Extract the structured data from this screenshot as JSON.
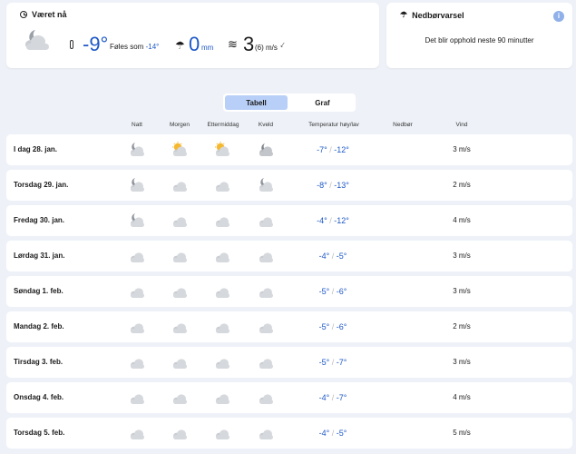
{
  "now": {
    "title": "Været nå",
    "temperature": "-9°",
    "feels_like_label": "Føles som",
    "feels_like_value": "-14°",
    "precipitation": "0",
    "precipitation_unit": "mm",
    "wind": "3",
    "gust": "(6) m/s",
    "icons": {
      "clock": "clock-icon",
      "symbol": "cloudy-moon-icon",
      "thermometer": "thermometer-icon",
      "umbrella": "umbrella-icon",
      "wind": "wind-icon",
      "direction": "wind-direction-arrow-icon"
    }
  },
  "precip_forecast": {
    "title": "Nedbørvarsel",
    "message": "Det blir opphold neste 90 minutter",
    "info": "i"
  },
  "view_toggle": {
    "table_label": "Tabell",
    "graph_label": "Graf",
    "active": "Tabell"
  },
  "columns": {
    "night": "Natt",
    "morning": "Morgen",
    "afternoon": "Ettermiddag",
    "evening": "Kveld",
    "temperature": "Temperatur høy/lav",
    "precipitation": "Nedbør",
    "wind": "Vind"
  },
  "colors": {
    "temperature": "#1e58c7",
    "active_tab": "#b8cff7",
    "background": "#eef2f8"
  },
  "rows": [
    {
      "day": "I dag 28. jan.",
      "symbols": [
        "moon-cloud",
        "sun-cloud",
        "sun-cloud",
        "moon-cloud-dark"
      ],
      "high": "-7°",
      "low": "-12°",
      "wind": "3 m/s"
    },
    {
      "day": "Torsdag 29. jan.",
      "symbols": [
        "moon-cloud",
        "cloud",
        "cloud",
        "moon-cloud"
      ],
      "high": "-8°",
      "low": "-13°",
      "wind": "2 m/s"
    },
    {
      "day": "Fredag 30. jan.",
      "symbols": [
        "moon-cloud",
        "cloud",
        "cloud",
        "cloud"
      ],
      "high": "-4°",
      "low": "-12°",
      "wind": "4 m/s"
    },
    {
      "day": "Lørdag 31. jan.",
      "symbols": [
        "cloud",
        "cloud",
        "cloud",
        "cloud"
      ],
      "high": "-4°",
      "low": "-5°",
      "wind": "3 m/s"
    },
    {
      "day": "Søndag 1. feb.",
      "symbols": [
        "cloud",
        "cloud",
        "cloud",
        "cloud"
      ],
      "high": "-5°",
      "low": "-6°",
      "wind": "3 m/s"
    },
    {
      "day": "Mandag 2. feb.",
      "symbols": [
        "cloud",
        "cloud",
        "cloud",
        "cloud"
      ],
      "high": "-5°",
      "low": "-6°",
      "wind": "2 m/s"
    },
    {
      "day": "Tirsdag 3. feb.",
      "symbols": [
        "cloud",
        "cloud",
        "cloud",
        "cloud"
      ],
      "high": "-5°",
      "low": "-7°",
      "wind": "3 m/s"
    },
    {
      "day": "Onsdag 4. feb.",
      "symbols": [
        "cloud",
        "cloud",
        "cloud",
        "cloud"
      ],
      "high": "-4°",
      "low": "-7°",
      "wind": "4 m/s"
    },
    {
      "day": "Torsdag 5. feb.",
      "symbols": [
        "cloud",
        "cloud",
        "cloud",
        "cloud"
      ],
      "high": "-4°",
      "low": "-5°",
      "wind": "5 m/s"
    }
  ]
}
